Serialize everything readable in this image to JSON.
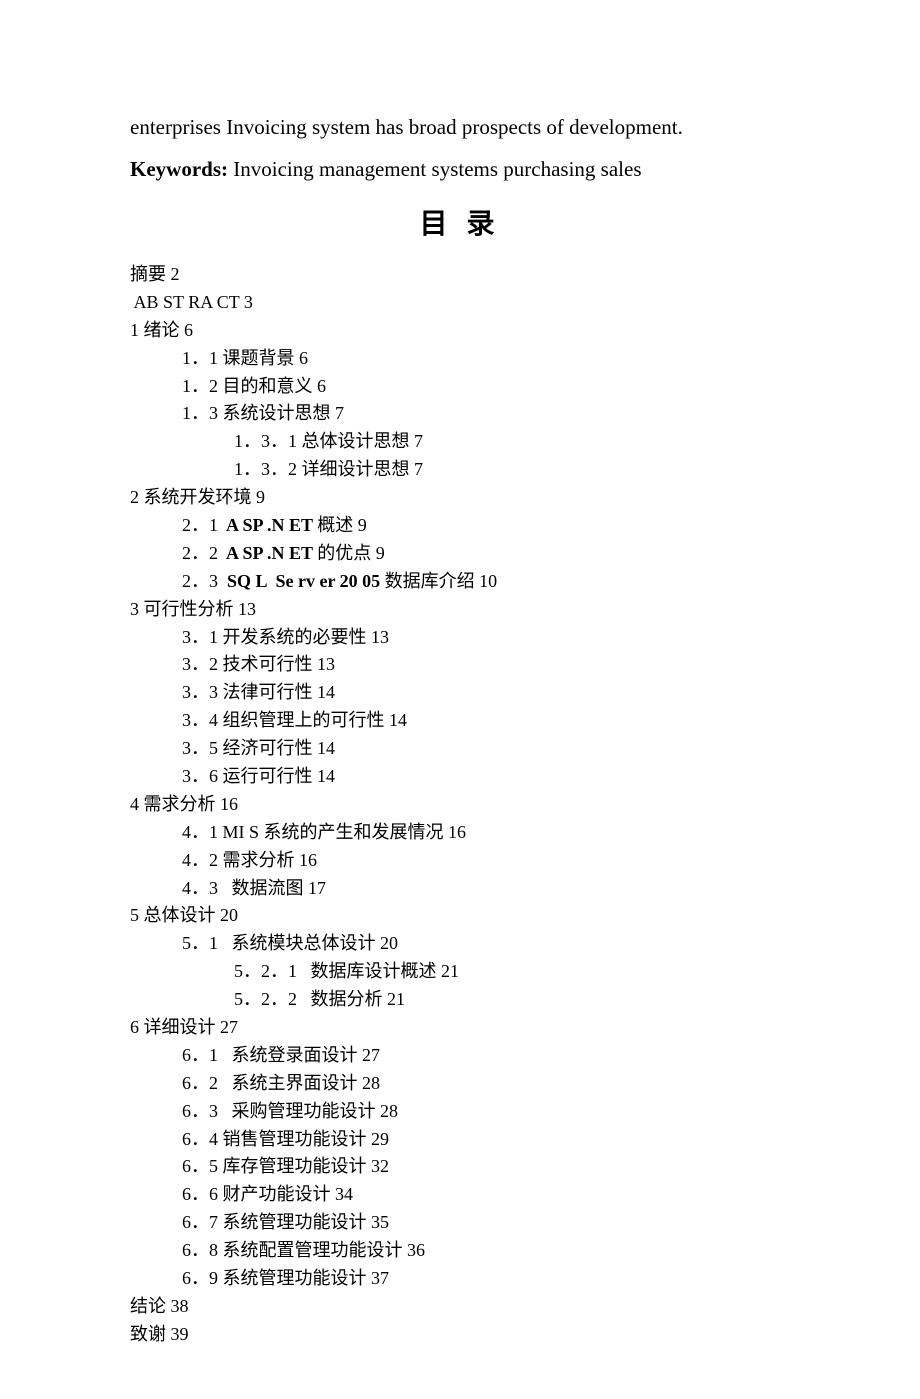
{
  "intro_text": "enterprises Invoicing system has broad prospects of development.",
  "keywords_label": "Keywords:",
  "keywords_rest": " Invoicing management systems    purchasing    sales",
  "toc_title": "目 录",
  "toc": [
    {
      "level": 0,
      "text": "摘要 ",
      "page": "2"
    },
    {
      "level": 0,
      "text": " AB ST RA CT ",
      "page": "3",
      "latin": true
    },
    {
      "level": 0,
      "text": "1 绪论 ",
      "page": "6"
    },
    {
      "level": 1,
      "text": "1．1 课题背景 ",
      "page": "6"
    },
    {
      "level": 1,
      "text": "1．2 目的和意义 ",
      "page": "6"
    },
    {
      "level": 1,
      "text": "1．3 系统设计思想 ",
      "page": "7"
    },
    {
      "level": 2,
      "text": "1．3．1 总体设计思想 ",
      "page": "7"
    },
    {
      "level": 2,
      "text": "1．3．2 详细设计思想 ",
      "page": "7"
    },
    {
      "level": 0,
      "text": "2 系统开发环境 ",
      "page": "9"
    },
    {
      "level": 1,
      "pre": "2．1 ",
      "latin_part": " A SP .N ET ",
      "post": "概述 ",
      "page": "9",
      "mixed": true
    },
    {
      "level": 1,
      "pre": "2．2 ",
      "latin_part": " A SP .N ET ",
      "post": "的优点 ",
      "page": "9",
      "mixed": true
    },
    {
      "level": 1,
      "pre": "2．3 ",
      "latin_part": " SQ L  Se rv er 20 05 ",
      "post": "数据库介绍 ",
      "page": "10",
      "mixed": true
    },
    {
      "level": 0,
      "text": "3 可行性分析 ",
      "page": "13"
    },
    {
      "level": 1,
      "text": "3．1 开发系统的必要性 ",
      "page": "13"
    },
    {
      "level": 1,
      "text": "3．2 技术可行性 ",
      "page": "13"
    },
    {
      "level": 1,
      "text": "3．3 法律可行性 ",
      "page": "14"
    },
    {
      "level": 1,
      "text": "3．4 组织管理上的可行性 ",
      "page": "14"
    },
    {
      "level": 1,
      "text": "3．5 经济可行性 ",
      "page": "14"
    },
    {
      "level": 1,
      "text": "3．6 运行可行性 ",
      "page": "14"
    },
    {
      "level": 0,
      "text": "4 需求分析 ",
      "page": "16"
    },
    {
      "level": 1,
      "text": "4．1 MI S 系统的产生和发展情况 ",
      "page": "16"
    },
    {
      "level": 1,
      "text": "4．2 需求分析 ",
      "page": "16"
    },
    {
      "level": 1,
      "text": "4．3   数据流图 ",
      "page": "17"
    },
    {
      "level": 0,
      "text": "5 总体设计 ",
      "page": "20"
    },
    {
      "level": 1,
      "text": "5．1   系统模块总体设计 ",
      "page": "20"
    },
    {
      "level": 2,
      "text": "5．2．1   数据库设计概述 ",
      "page": "21"
    },
    {
      "level": 2,
      "text": "5．2．2   数据分析 ",
      "page": "21"
    },
    {
      "level": 0,
      "text": "6 详细设计 ",
      "page": "27"
    },
    {
      "level": 1,
      "text": "6．1   系统登录面设计 ",
      "page": "27"
    },
    {
      "level": 1,
      "text": "6．2   系统主界面设计 ",
      "page": "28"
    },
    {
      "level": 1,
      "text": "6．3   采购管理功能设计 ",
      "page": "28"
    },
    {
      "level": 1,
      "text": "6．4 销售管理功能设计 ",
      "page": "29"
    },
    {
      "level": 1,
      "text": "6．5 库存管理功能设计 ",
      "page": "32"
    },
    {
      "level": 1,
      "text": "6．6 财产功能设计 ",
      "page": "34"
    },
    {
      "level": 1,
      "text": "6．7 系统管理功能设计 ",
      "page": "35"
    },
    {
      "level": 1,
      "text": "6．8 系统配置管理功能设计 ",
      "page": "36"
    },
    {
      "level": 1,
      "text": "6．9 系统管理功能设计 ",
      "page": "37"
    },
    {
      "level": 0,
      "text": "结论 ",
      "page": "38"
    },
    {
      "level": 0,
      "text": "致谢 ",
      "page": "39"
    }
  ]
}
